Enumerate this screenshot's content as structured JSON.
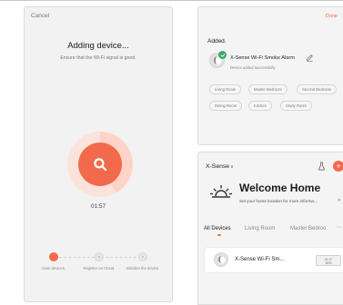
{
  "adding_screen": {
    "cancel_label": "Cancel",
    "title": "Adding device...",
    "subtitle": "Ensure that the Wi-Fi signal is good.",
    "timer": "01:57",
    "progress_fraction": 0.42,
    "accent_color": "#f26a4b",
    "center_icon": "search-icon",
    "steps": [
      {
        "label": "Scan devices.",
        "state": "active"
      },
      {
        "label": "Register on Cloud.",
        "state": "pending"
      },
      {
        "label": "Initialize the device.",
        "state": "pending"
      }
    ]
  },
  "added_screen": {
    "done_label": "Done",
    "heading": "Added.",
    "device_name": "X-Sense Wi-Fi Smoke Alarm",
    "status": "Device added successfully",
    "rooms": [
      "Living Room",
      "Master Bedroom",
      "Second Bedroom",
      "Dining Room",
      "Kitchen",
      "Study Room"
    ],
    "success_color": "#3aa86b"
  },
  "home_screen": {
    "brand": "X-Sense",
    "welcome_title": "Welcome Home",
    "welcome_subtitle": "Set your home location for more informa...",
    "tabs": [
      "All Devices",
      "Living Room",
      "Master Bedroo"
    ],
    "active_tab": "All Devices",
    "device_card": {
      "name": "X-Sense Wi-Fi Sm...",
      "temp_line1": "21.0°",
      "temp_line2": "50%"
    }
  }
}
